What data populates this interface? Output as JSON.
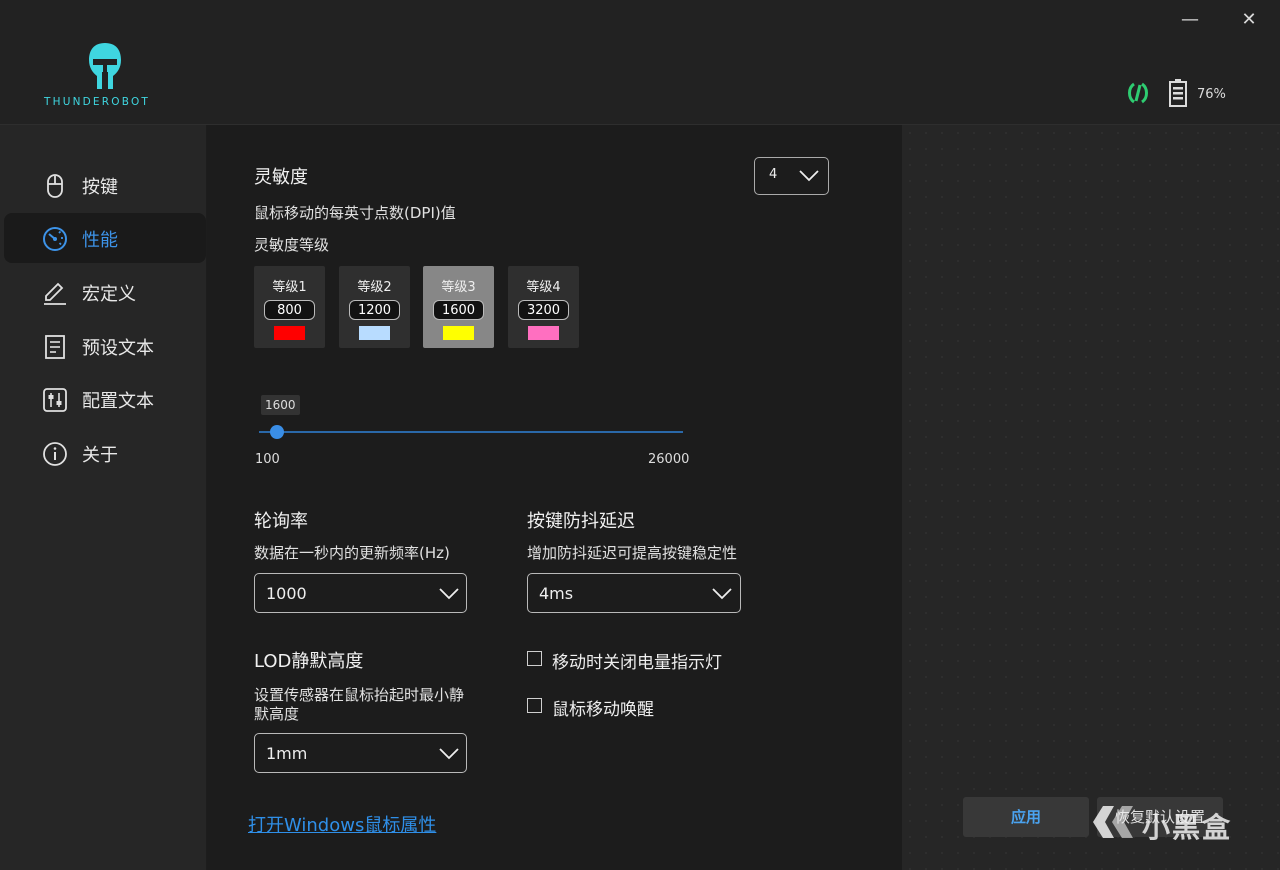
{
  "brand": {
    "name": "THUNDEROBOT",
    "accent": "#3fd6e0"
  },
  "window": {
    "minimize_glyph": "—",
    "close_glyph": "✕"
  },
  "status": {
    "battery_percent": "76%",
    "link_icon": "wireless-link-icon",
    "battery_icon": "battery-icon",
    "link_color": "#2ecc71"
  },
  "sidebar": {
    "items": [
      {
        "label": "按键",
        "icon": "mouse-icon",
        "active": false
      },
      {
        "label": "性能",
        "icon": "speedometer-icon",
        "active": true
      },
      {
        "label": "宏定义",
        "icon": "pencil-icon",
        "active": false
      },
      {
        "label": "预设文本",
        "icon": "document-icon",
        "active": false
      },
      {
        "label": "配置文本",
        "icon": "sliders-icon",
        "active": false
      },
      {
        "label": "关于",
        "icon": "info-icon",
        "active": false
      }
    ],
    "active_color": "#3d93e8"
  },
  "sensitivity": {
    "title": "灵敏度",
    "desc": "鼠标移动的每英寸点数(DPI)值",
    "levels_label": "灵敏度等级",
    "level_count": "4",
    "levels": [
      {
        "name": "等级1",
        "dpi": "800",
        "color": "#ff0000",
        "active": false
      },
      {
        "name": "等级2",
        "dpi": "1200",
        "color": "#b8dcff",
        "active": false
      },
      {
        "name": "等级3",
        "dpi": "1600",
        "color": "#ffff00",
        "active": true
      },
      {
        "name": "等级4",
        "dpi": "3200",
        "color": "#ff6fc0",
        "active": false
      }
    ],
    "slider": {
      "value": "1600",
      "min": "100",
      "max": "26000"
    }
  },
  "polling": {
    "title": "轮询率",
    "desc": "数据在一秒内的更新频率(Hz)",
    "value": "1000"
  },
  "debounce": {
    "title": "按键防抖延迟",
    "desc": "增加防抖延迟可提高按键稳定性",
    "value": "4ms"
  },
  "lod": {
    "title": "LOD静默高度",
    "desc_line1": "设置传感器在鼠标抬起时最小静",
    "desc_line2": "默高度",
    "value": "1mm"
  },
  "options": {
    "battery_led_off": {
      "label": "移动时关闭电量指示灯",
      "checked": false
    },
    "wake_on_move": {
      "label": "鼠标移动唤醒",
      "checked": false
    }
  },
  "link_text": "打开Windows鼠标属性",
  "buttons": {
    "apply": "应用",
    "reset": "恢复默认设置"
  },
  "watermark": {
    "text": "小黑盒"
  }
}
